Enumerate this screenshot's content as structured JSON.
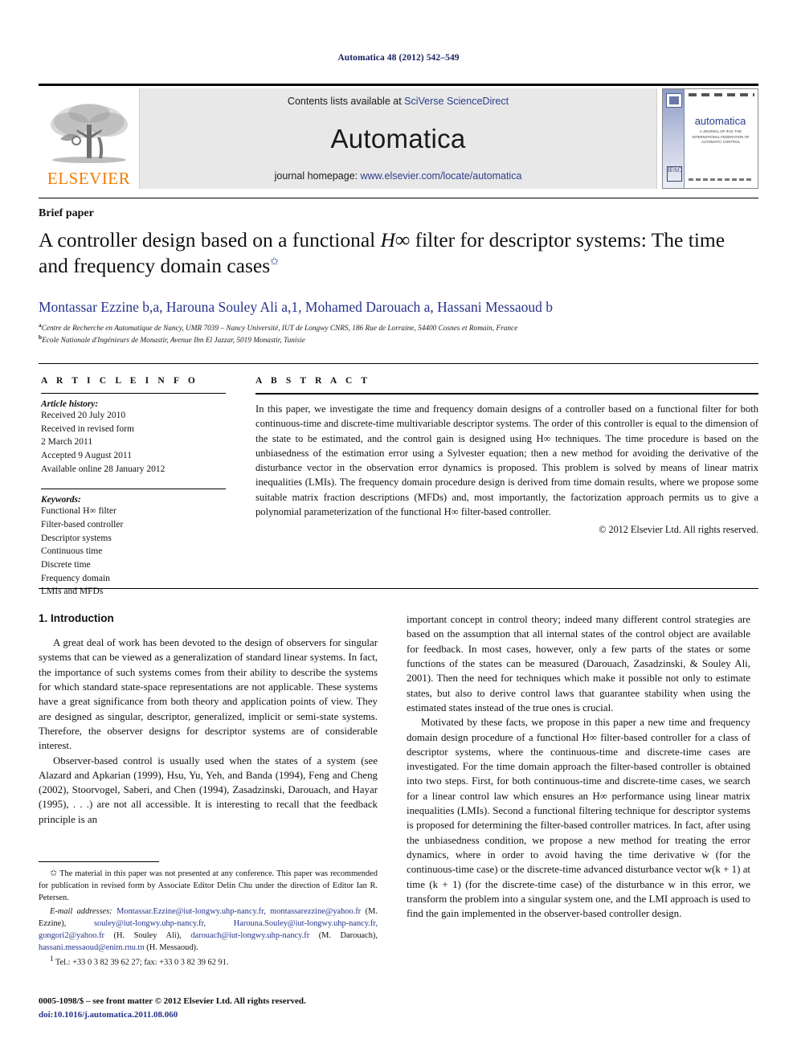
{
  "running_head": "Automatica 48 (2012) 542–549",
  "masthead": {
    "publisher_logo_label": "ELSEVIER",
    "contents_prefix": "Contents lists available at ",
    "contents_link": "SciVerse ScienceDirect",
    "journal_name": "Automatica",
    "homepage_prefix": "journal homepage: ",
    "homepage_link": "www.elsevier.com/locate/automatica",
    "cover": {
      "title": "automatica",
      "subtitle": "A JOURNAL OF IFAC THE INTERNATIONAL FEDERATION OF AUTOMATIC CONTROL",
      "bottom_mark": "IFAC"
    }
  },
  "article": {
    "type_label": "Brief paper",
    "title_part1": "A controller design based on a functional ",
    "title_math": "H∞",
    "title_part2": " filter for descriptor systems: The time and frequency domain cases",
    "title_star": "✩",
    "authors": "Montassar Ezzine b,a, Harouna Souley Ali a,1, Mohamed Darouach a, Hassani Messaoud b",
    "affiliation_a_marker": "a",
    "affiliation_a": "Centre de Recherche en Automatique de Nancy, UMR 7039 – Nancy Université, IUT de Longwy CNRS, 186 Rue de Lorraine, 54400 Cosnes et Romain, France",
    "affiliation_b_marker": "b",
    "affiliation_b": "Ecole Nationale d'Ingénieurs de Monastir, Avenue Ibn El Jazzar, 5019 Monastir, Tunisie"
  },
  "article_info": {
    "heading": "A R T I C L E   I N F O",
    "history_label": "Article history:",
    "history_lines": [
      "Received 20 July 2010",
      "Received in revised form",
      "2 March 2011",
      "Accepted 9 August 2011",
      "Available online 28 January 2012"
    ],
    "keywords_label": "Keywords:",
    "keywords": [
      "Functional H∞ filter",
      "Filter-based controller",
      "Descriptor systems",
      "Continuous time",
      "Discrete time",
      "Frequency domain",
      "LMIs and MFDs"
    ]
  },
  "abstract": {
    "heading": "A B S T R A C T",
    "text": "In this paper, we investigate the time and frequency domain designs of a controller based on a functional filter for both continuous-time and discrete-time multivariable descriptor systems. The order of this controller is equal to the dimension of the state to be estimated, and the control gain is designed using H∞ techniques. The time procedure is based on the unbiasedness of the estimation error using a Sylvester equation; then a new method for avoiding the derivative of the disturbance vector in the observation error dynamics is proposed. This problem is solved by means of linear matrix inequalities (LMIs). The frequency domain procedure design is derived from time domain results, where we propose some suitable matrix fraction descriptions (MFDs) and, most importantly, the factorization approach permits us to give a polynomial parameterization of the functional H∞ filter-based controller.",
    "copyright": "© 2012 Elsevier Ltd. All rights reserved."
  },
  "body": {
    "section_heading": "1. Introduction",
    "left_paragraphs": [
      "A great deal of work has been devoted to the design of observers for singular systems that can be viewed as a generalization of standard linear systems. In fact, the importance of such systems comes from their ability to describe the systems for which standard state-space representations are not applicable. These systems have a great significance from both theory and application points of view. They are designed as singular, descriptor, generalized, implicit or semi-state systems. Therefore, the observer designs for descriptor systems are of considerable interest.",
      "Observer-based control is usually used when the states of a system (see Alazard and Apkarian (1999), Hsu, Yu, Yeh, and Banda (1994), Feng and Cheng (2002), Stoorvogel, Saberi, and Chen (1994), Zasadzinski, Darouach, and Hayar (1995), . . .) are not all accessible. It is interesting to recall that the feedback principle is an"
    ],
    "right_paragraphs": [
      "important concept in control theory; indeed many different control strategies are based on the assumption that all internal states of the control object are available for feedback. In most cases, however, only a few parts of the states or some functions of the states can be measured (Darouach, Zasadzinski, & Souley Ali, 2001). Then the need for techniques which make it possible not only to estimate states, but also to derive control laws that guarantee stability when using the estimated states instead of the true ones is crucial.",
      "Motivated by these facts, we propose in this paper a new time and frequency domain design procedure of a functional H∞ filter-based controller for a class of descriptor systems, where the continuous-time and discrete-time cases are investigated. For the time domain approach the filter-based controller is obtained into two steps. First, for both continuous-time and discrete-time cases, we search for a linear control law which ensures an H∞ performance using linear matrix inequalities (LMIs). Second a functional filtering technique for descriptor systems is proposed for determining the filter-based controller matrices. In fact, after using the unbiasedness condition, we propose a new method for treating the error dynamics, where in order to avoid having the time derivative ẇ (for the continuous-time case) or the discrete-time advanced disturbance vector w(k + 1) at time (k + 1) (for the discrete-time case) of the disturbance w in this error, we transform the problem into a singular system one, and the LMI approach is used to find the gain implemented in the observer-based controller design."
    ]
  },
  "footnotes": {
    "star_marker": "✩",
    "star_text": "The material in this paper was not presented at any conference. This paper was recommended for publication in revised form by Associate Editor Delin Chu under the direction of Editor Ian R. Petersen.",
    "email_label": "E-mail addresses:",
    "email_text_1": "Montassar.Ezzine@iut-longwy.uhp-nancy.fr,",
    "email_text_2": "montassarezzine@yahoo.fr",
    "email_owner_2": " (M. Ezzine), ",
    "email_text_3": "souley@iut-longwy.uhp-nancy.fr,",
    "email_text_4": "Harouna.Souley@iut-longwy.uhp-nancy.fr,",
    "email_text_5": "gongori2@yahoo.fr",
    "email_owner_5": " (H. Souley Ali),",
    "email_text_6": "darouach@iut-longwy.uhp-nancy.fr",
    "email_owner_6": " (M. Darouach),",
    "email_text_7": "hassani.messaoud@enim.rnu.tn",
    "email_owner_7": " (H. Messaoud).",
    "tel_marker": "1",
    "tel_text": "Tel.: +33 0 3 82 39 62 27; fax: +33 0 3 82 39 62 91."
  },
  "imprint": {
    "issn_line": "0005-1098/$ – see front matter © 2012 Elsevier Ltd. All rights reserved.",
    "doi_line": "doi:10.1016/j.automatica.2011.08.060"
  },
  "colors": {
    "link_blue": "#27348b",
    "elsevier_orange": "#f07d00",
    "contents_bg": "#e8e8e8",
    "text_black": "#111111"
  }
}
